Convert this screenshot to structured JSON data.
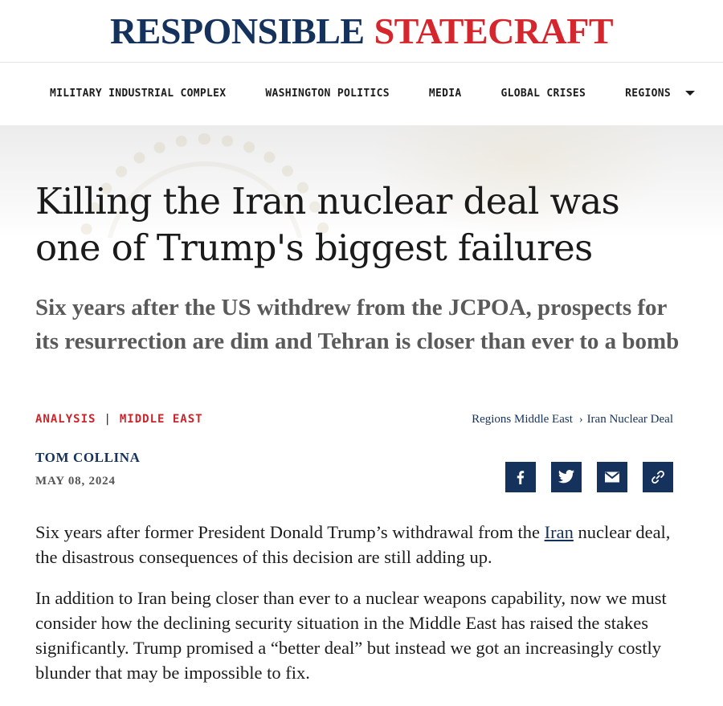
{
  "site": {
    "logo_part1": "RESPONSIBLE",
    "logo_part2": "STATECRAFT"
  },
  "nav": {
    "items": [
      {
        "label": "MILITARY INDUSTRIAL COMPLEX"
      },
      {
        "label": "WASHINGTON POLITICS"
      },
      {
        "label": "MEDIA"
      },
      {
        "label": "GLOBAL CRISES"
      },
      {
        "label": "REGIONS"
      }
    ]
  },
  "article": {
    "title": "Killing the Iran nuclear deal was one of Trump's biggest failures",
    "subtitle": "Six years after the US withdrew from the JCPOA, prospects for its resurrection are dim and Tehran is closer than ever to a bomb",
    "tags": [
      "ANALYSIS",
      "MIDDLE EAST"
    ],
    "tag_separator": "|",
    "breadcrumbs": [
      "Regions Middle East",
      "Iran Nuclear Deal"
    ],
    "breadcrumb_arrow": "›",
    "author": "TOM COLLINA",
    "date": "MAY 08, 2024",
    "paragraph1_before_link": "Six years after former President Donald Trump’s withdrawal from the ",
    "paragraph1_link": "Iran",
    "paragraph1_after_link": " nuclear deal, the disastrous consequences of this decision are still adding up.",
    "paragraph2": "In addition to Iran being closer than ever to a nuclear weapons capability, now we must consider how the declining security situation in the Middle East has raised the stakes significantly. Trump promised a “better deal” but instead we got an increasingly costly blunder that may be impossible to fix."
  },
  "share": {
    "icons": [
      "facebook-icon",
      "twitter-icon",
      "email-icon",
      "link-icon"
    ]
  },
  "colors": {
    "navy": "#14325c",
    "red": "#d4262c",
    "tag_red": "#c8262c"
  }
}
